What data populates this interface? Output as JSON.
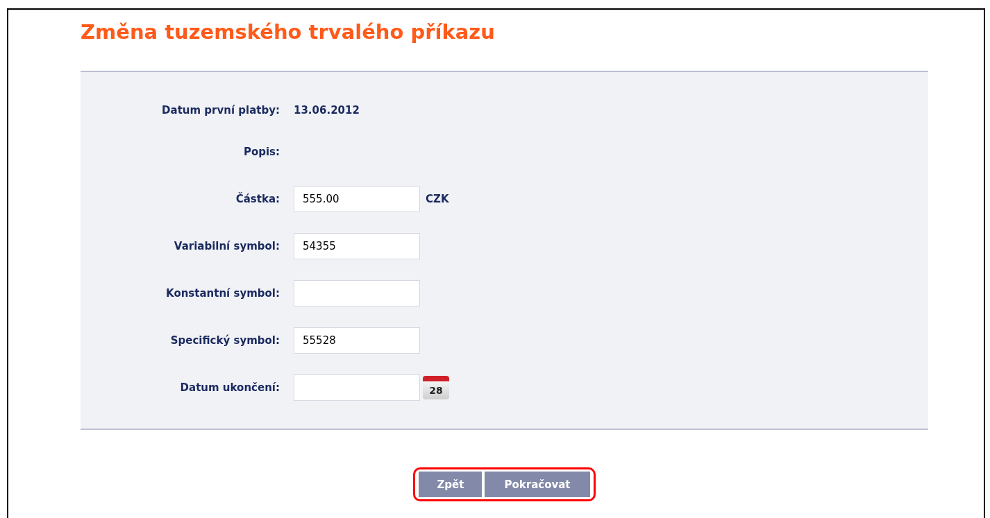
{
  "title": "Změna tuzemského trvalého příkazu",
  "fields": [
    {
      "kind": "value",
      "label": "Datum první platby:",
      "value": "13.06.2012"
    },
    {
      "kind": "label",
      "label": "Popis:"
    },
    {
      "kind": "input",
      "label": "Částka:",
      "value": "555.00",
      "suffix": "CZK"
    },
    {
      "kind": "input",
      "label": "Variabilní symbol:",
      "value": "54355"
    },
    {
      "kind": "input",
      "label": "Konstantní symbol:"
    },
    {
      "kind": "input",
      "label": "Specifický symbol:",
      "value": "55528"
    },
    {
      "kind": "date",
      "label": "Datum ukončení:",
      "calendar_day": "28"
    }
  ],
  "buttons": [
    {
      "label": "Zpět"
    },
    {
      "label": "Pokračovat"
    }
  ],
  "highlighted_buttons": true
}
